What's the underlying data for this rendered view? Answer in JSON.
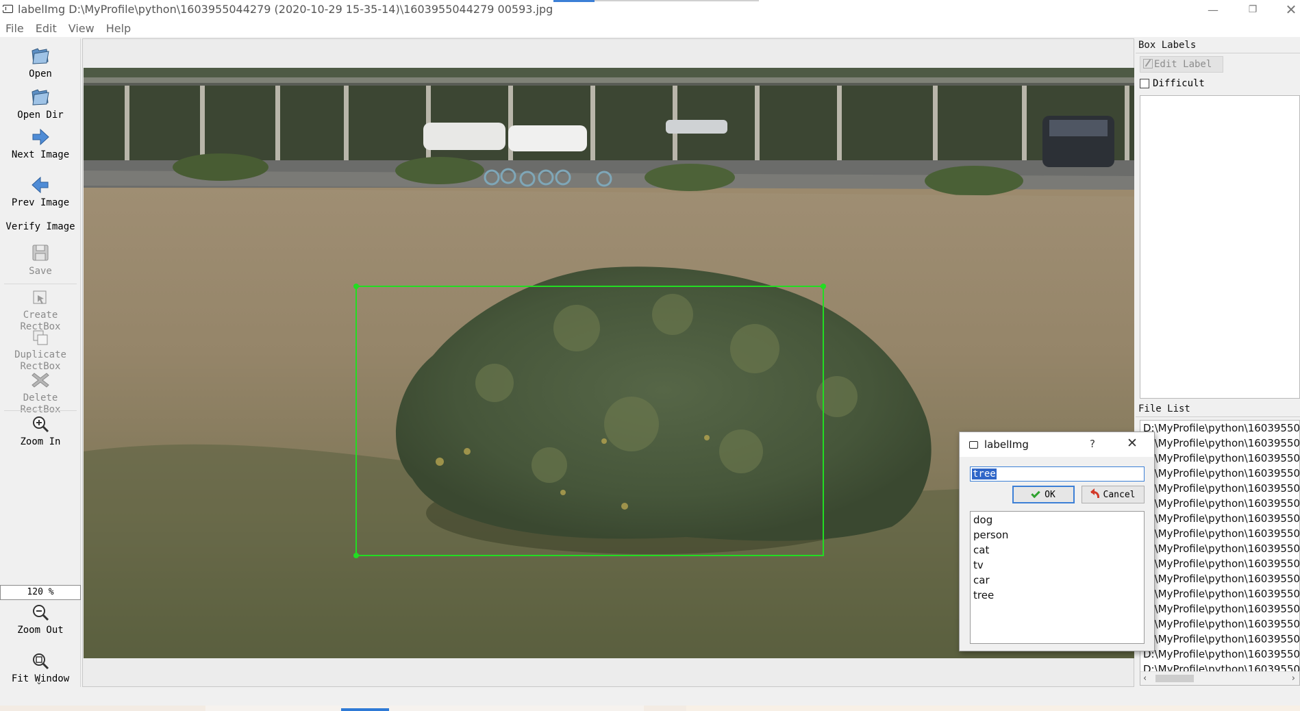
{
  "window": {
    "title": "labelImg D:\\MyProfile\\python\\1603955044279 (2020-10-29 15-35-14)\\1603955044279 00593.jpg",
    "minimize": "—",
    "maximize": "❐",
    "close": "✕"
  },
  "menu": [
    "File",
    "Edit",
    "View",
    "Help"
  ],
  "toolbar": {
    "open": "Open",
    "open_dir": "Open Dir",
    "next_image": "Next Image",
    "prev_image": "Prev Image",
    "verify_image": "Verify Image",
    "save": "Save",
    "create_rectbox": [
      "Create",
      "RectBox"
    ],
    "duplicate_rectbox": [
      "Duplicate",
      "RectBox"
    ],
    "delete_rectbox": [
      "Delete",
      "RectBox"
    ],
    "zoom_in": "Zoom In",
    "zoom_value": "120 %",
    "zoom_out": "Zoom Out",
    "fit_window": "Fit Window",
    "more": "⌄"
  },
  "box_labels": {
    "header": "Box Labels",
    "edit_label": "Edit Label",
    "difficult": "Difficult"
  },
  "file_list": {
    "header": "File List",
    "items": [
      "D:\\MyProfile\\python\\16039550",
      "D:\\MyProfile\\python\\16039550",
      "D:\\MyProfile\\python\\16039550",
      "D:\\MyProfile\\python\\16039550",
      "D:\\MyProfile\\python\\16039550",
      "D:\\MyProfile\\python\\16039550",
      "D:\\MyProfile\\python\\16039550",
      "D:\\MyProfile\\python\\16039550",
      "D:\\MyProfile\\python\\16039550",
      "D:\\MyProfile\\python\\16039550",
      "D:\\MyProfile\\python\\16039550",
      "D:\\MyProfile\\python\\16039550",
      "D:\\MyProfile\\python\\16039550",
      "D:\\MyProfile\\python\\16039550",
      "D:\\MyProfile\\python\\16039550",
      "D:\\MyProfile\\python\\16039550",
      "D:\\MyProfile\\python\\16039550"
    ]
  },
  "dialog": {
    "title": "labelImg",
    "help": "?",
    "close": "✕",
    "input_value": "tree",
    "ok": "OK",
    "cancel": "Cancel",
    "labels": [
      "dog",
      "person",
      "cat",
      "tv",
      "car",
      "tree"
    ]
  },
  "colors": {
    "bbox": "#22dd22",
    "selection": "#2f66c8",
    "accent": "#3c7fd6"
  }
}
